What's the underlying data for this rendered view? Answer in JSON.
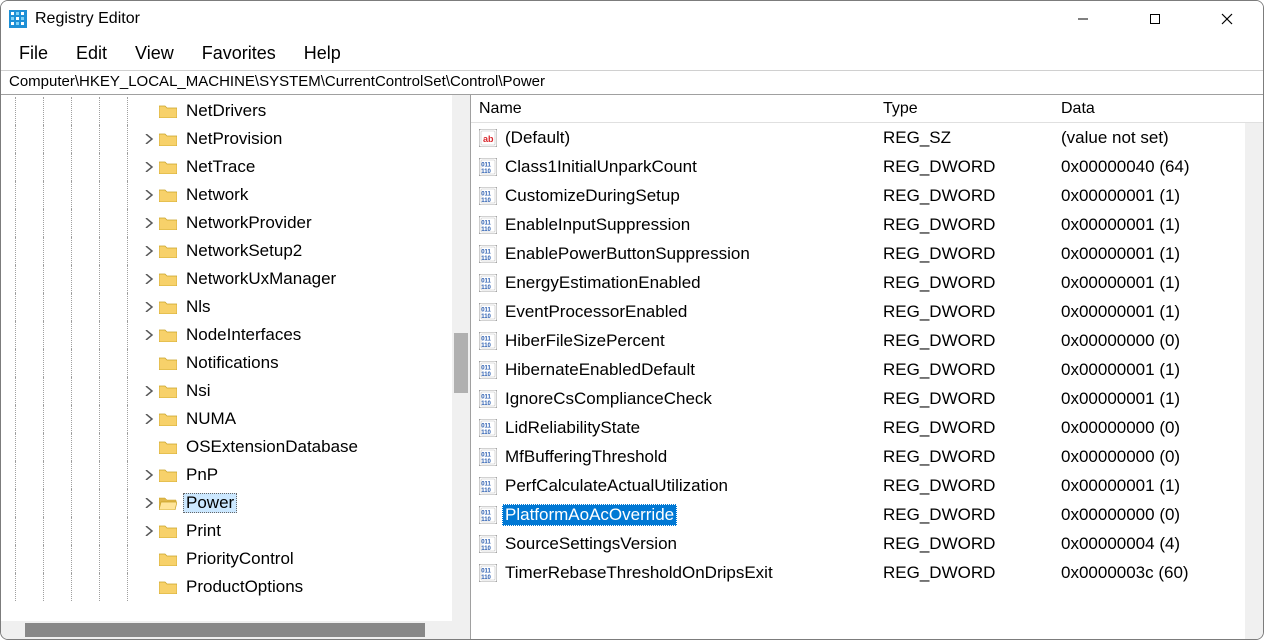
{
  "window": {
    "title": "Registry Editor"
  },
  "menubar": {
    "items": [
      "File",
      "Edit",
      "View",
      "Favorites",
      "Help"
    ]
  },
  "addressbar": "Computer\\HKEY_LOCAL_MACHINE\\SYSTEM\\CurrentControlSet\\Control\\Power",
  "tree": {
    "indent_depth_base": 5,
    "items": [
      {
        "label": "NetDrivers",
        "expandable": false,
        "selected": false
      },
      {
        "label": "NetProvision",
        "expandable": true,
        "selected": false
      },
      {
        "label": "NetTrace",
        "expandable": true,
        "selected": false
      },
      {
        "label": "Network",
        "expandable": true,
        "selected": false
      },
      {
        "label": "NetworkProvider",
        "expandable": true,
        "selected": false
      },
      {
        "label": "NetworkSetup2",
        "expandable": true,
        "selected": false
      },
      {
        "label": "NetworkUxManager",
        "expandable": true,
        "selected": false
      },
      {
        "label": "Nls",
        "expandable": true,
        "selected": false
      },
      {
        "label": "NodeInterfaces",
        "expandable": true,
        "selected": false
      },
      {
        "label": "Notifications",
        "expandable": false,
        "selected": false
      },
      {
        "label": "Nsi",
        "expandable": true,
        "selected": false
      },
      {
        "label": "NUMA",
        "expandable": true,
        "selected": false
      },
      {
        "label": "OSExtensionDatabase",
        "expandable": false,
        "selected": false
      },
      {
        "label": "PnP",
        "expandable": true,
        "selected": false
      },
      {
        "label": "Power",
        "expandable": true,
        "selected": true
      },
      {
        "label": "Print",
        "expandable": true,
        "selected": false
      },
      {
        "label": "PriorityControl",
        "expandable": false,
        "selected": false
      },
      {
        "label": "ProductOptions",
        "expandable": false,
        "selected": false
      }
    ]
  },
  "list": {
    "columns": {
      "name": "Name",
      "type": "Type",
      "data": "Data"
    },
    "rows": [
      {
        "icon": "sz",
        "name": "(Default)",
        "type": "REG_SZ",
        "data": "(value not set)",
        "selected": false
      },
      {
        "icon": "dword",
        "name": "Class1InitialUnparkCount",
        "type": "REG_DWORD",
        "data": "0x00000040 (64)",
        "selected": false
      },
      {
        "icon": "dword",
        "name": "CustomizeDuringSetup",
        "type": "REG_DWORD",
        "data": "0x00000001 (1)",
        "selected": false
      },
      {
        "icon": "dword",
        "name": "EnableInputSuppression",
        "type": "REG_DWORD",
        "data": "0x00000001 (1)",
        "selected": false
      },
      {
        "icon": "dword",
        "name": "EnablePowerButtonSuppression",
        "type": "REG_DWORD",
        "data": "0x00000001 (1)",
        "selected": false
      },
      {
        "icon": "dword",
        "name": "EnergyEstimationEnabled",
        "type": "REG_DWORD",
        "data": "0x00000001 (1)",
        "selected": false
      },
      {
        "icon": "dword",
        "name": "EventProcessorEnabled",
        "type": "REG_DWORD",
        "data": "0x00000001 (1)",
        "selected": false
      },
      {
        "icon": "dword",
        "name": "HiberFileSizePercent",
        "type": "REG_DWORD",
        "data": "0x00000000 (0)",
        "selected": false
      },
      {
        "icon": "dword",
        "name": "HibernateEnabledDefault",
        "type": "REG_DWORD",
        "data": "0x00000001 (1)",
        "selected": false
      },
      {
        "icon": "dword",
        "name": "IgnoreCsComplianceCheck",
        "type": "REG_DWORD",
        "data": "0x00000001 (1)",
        "selected": false
      },
      {
        "icon": "dword",
        "name": "LidReliabilityState",
        "type": "REG_DWORD",
        "data": "0x00000000 (0)",
        "selected": false
      },
      {
        "icon": "dword",
        "name": "MfBufferingThreshold",
        "type": "REG_DWORD",
        "data": "0x00000000 (0)",
        "selected": false
      },
      {
        "icon": "dword",
        "name": "PerfCalculateActualUtilization",
        "type": "REG_DWORD",
        "data": "0x00000001 (1)",
        "selected": false
      },
      {
        "icon": "dword",
        "name": "PlatformAoAcOverride",
        "type": "REG_DWORD",
        "data": "0x00000000 (0)",
        "selected": true
      },
      {
        "icon": "dword",
        "name": "SourceSettingsVersion",
        "type": "REG_DWORD",
        "data": "0x00000004 (4)",
        "selected": false
      },
      {
        "icon": "dword",
        "name": "TimerRebaseThresholdOnDripsExit",
        "type": "REG_DWORD",
        "data": "0x0000003c (60)",
        "selected": false
      }
    ]
  }
}
